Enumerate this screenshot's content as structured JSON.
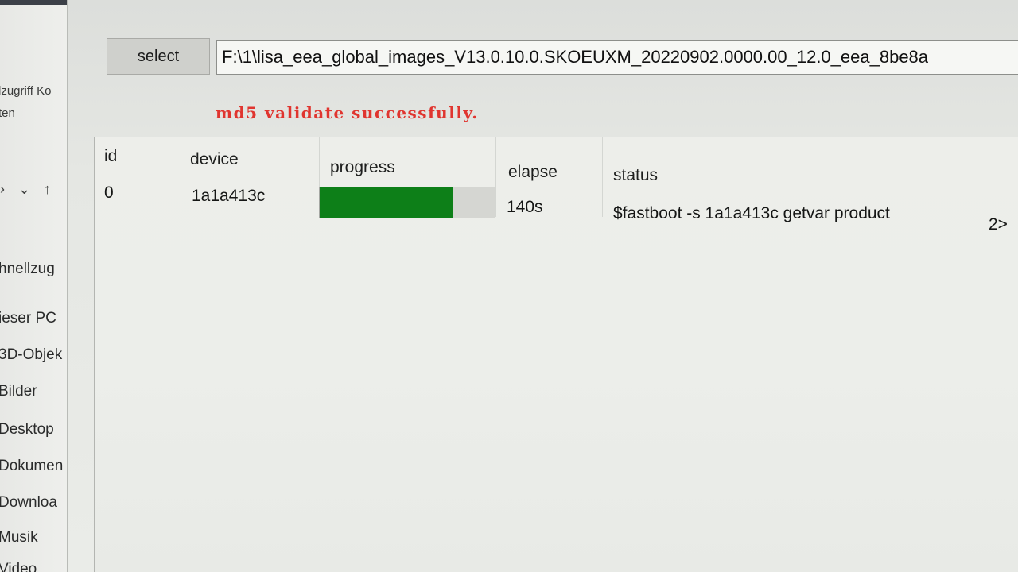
{
  "explorer": {
    "header_line1": "lzugriff Ko",
    "header_line2": "ten",
    "nav_icons": [
      "›",
      "⌄",
      "↑"
    ],
    "items": [
      {
        "label": "hnellzug"
      },
      {
        "label": "ieser PC"
      },
      {
        "label": "3D-Objek"
      },
      {
        "label": "Bilder"
      },
      {
        "label": "Desktop"
      },
      {
        "label": "Dokumen"
      },
      {
        "label": "Downloa"
      },
      {
        "label": "Musik"
      },
      {
        "label": "Video"
      }
    ]
  },
  "toolbar": {
    "select_label": "select",
    "path_value": "F:\\1\\lisa_eea_global_images_V13.0.10.0.SKOEUXM_20220902.0000.00_12.0_eea_8be8a"
  },
  "md5_status": "md5 validate successfully.",
  "colors": {
    "progress_fill": "#0d7f18",
    "md5_text": "#e0352f"
  },
  "table": {
    "columns": {
      "id": "id",
      "device": "device",
      "progress": "progress",
      "elapse": "elapse",
      "status": "status"
    },
    "rows": [
      {
        "id": "0",
        "device": "1a1a413c",
        "progress": 0.76,
        "elapse": "140s",
        "status": "$fastboot -s 1a1a413c getvar product",
        "status_tail": "2>"
      }
    ]
  }
}
